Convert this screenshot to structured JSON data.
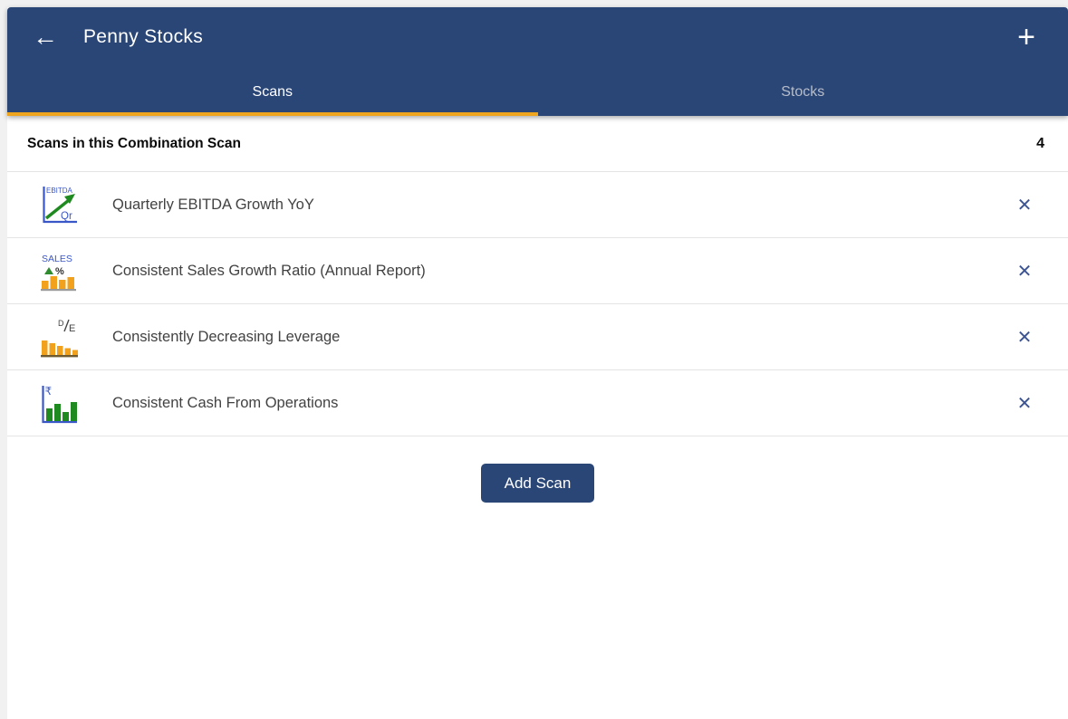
{
  "header": {
    "title": "Penny Stocks",
    "tabs": [
      {
        "label": "Scans",
        "active": true
      },
      {
        "label": "Stocks",
        "active": false
      }
    ]
  },
  "icons": {
    "back": "←",
    "plus": "+",
    "close": "✕"
  },
  "section": {
    "title": "Scans in this Combination Scan",
    "count": "4"
  },
  "scans": [
    {
      "label": "Quarterly EBITDA Growth YoY",
      "icon": "ebitda-quarterly-growth-chart",
      "icon_text": {
        "top": "EBITDA",
        "bottom": "Qr"
      }
    },
    {
      "label": "Consistent Sales Growth Ratio (Annual Report)",
      "icon": "sales-growth-bar-chart",
      "icon_text": {
        "top": "SALES",
        "triangle": "▲",
        "percent": "%"
      }
    },
    {
      "label": "Consistently Decreasing Leverage",
      "icon": "debt-equity-decreasing-bars",
      "icon_text": {
        "d": "D",
        "e": "E"
      }
    },
    {
      "label": "Consistent Cash From Operations",
      "icon": "rupee-cash-bar-chart",
      "icon_text": {
        "currency": "₹"
      }
    }
  ],
  "actions": {
    "add_scan": "Add Scan"
  },
  "colors": {
    "header_bg": "#2a4677",
    "active_tab_underline": "#f0a51f",
    "inactive_tab_text": "#b6bdca",
    "close_icon": "#3d5492",
    "button_bg": "#2a4677",
    "icon_blue": "#3a57c8",
    "icon_green": "#1f8a1f",
    "icon_orange": "#f2a11d"
  }
}
